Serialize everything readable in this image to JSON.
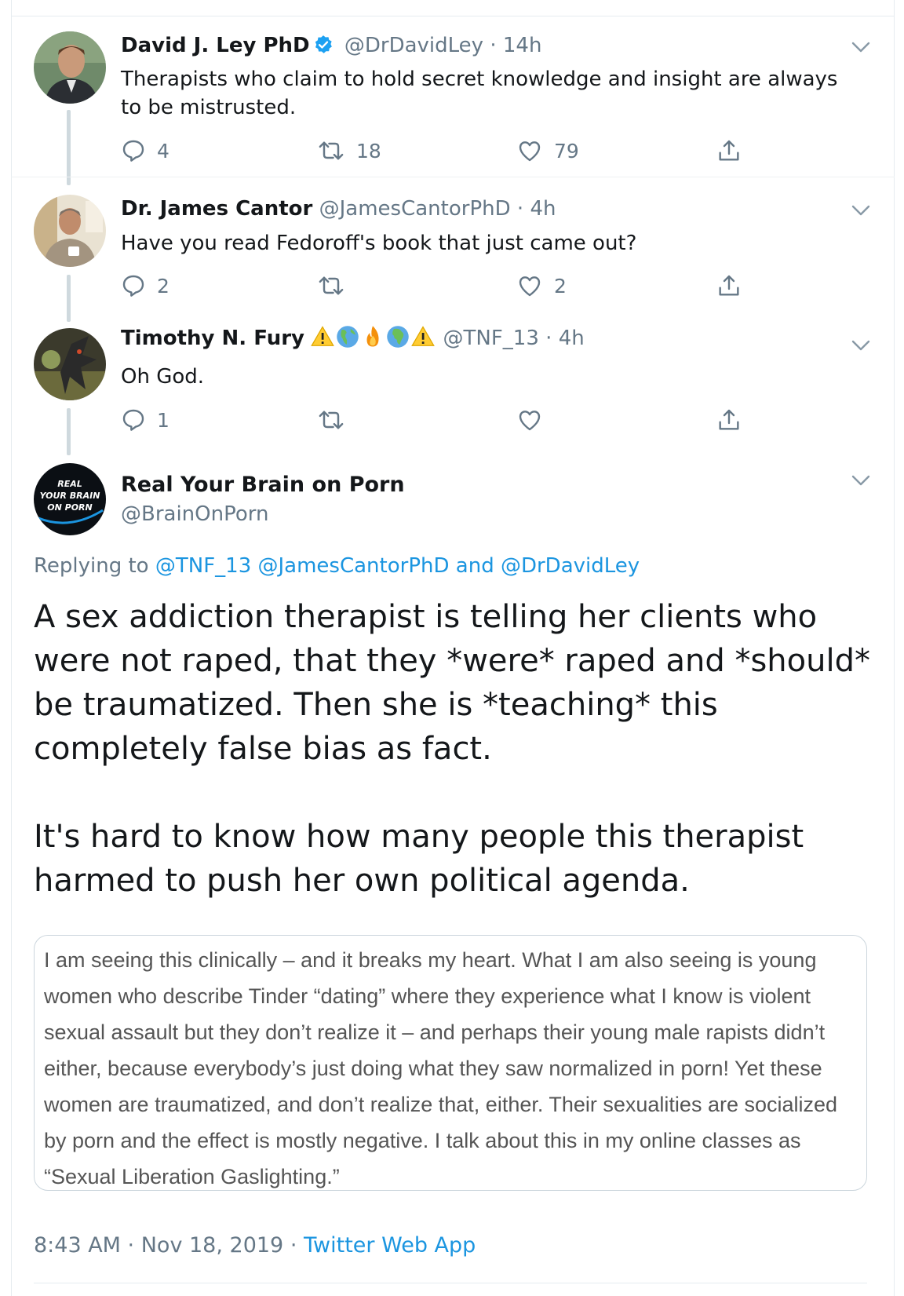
{
  "tweets": [
    {
      "name": "David J. Ley PhD",
      "handle": "@DrDavidLey",
      "separator": "·",
      "time": "14h",
      "text": "Therapists who claim to hold secret knowledge and insight are always to be mistrusted.",
      "reply_count": "4",
      "retweet_count": "18",
      "like_count": "79"
    },
    {
      "name": "Dr. James Cantor",
      "handle": "@JamesCantorPhD",
      "separator": "·",
      "time": "4h",
      "text": "Have you read Fedoroff's book that just came out?",
      "reply_count": "2",
      "retweet_count": "",
      "like_count": "2"
    },
    {
      "name": "Timothy N. Fury",
      "handle": "@TNF_13",
      "separator": "·",
      "time": "4h",
      "text": "Oh God.",
      "reply_count": "1",
      "retweet_count": "",
      "like_count": ""
    }
  ],
  "main_tweet": {
    "name": "Real Your Brain on Porn",
    "handle": "@BrainOnPorn",
    "avatar_text": [
      "REAL",
      "YOUR BRAIN",
      "ON PORN"
    ],
    "replying_prefix": "Replying to",
    "replying_to": [
      "@TNF_13",
      "@JamesCantorPhD",
      "@DrDavidLey"
    ],
    "replying_and": "and",
    "paragraphs": [
      "A sex addiction therapist is telling her clients who were not raped, that they *were* raped and *should* be traumatized. Then she is *teaching* this completely false bias as fact.",
      "It's hard to know how many people this therapist harmed to push her own political agenda."
    ],
    "quote_text": "I am seeing this clinically – and it breaks my heart. What I am also seeing is young women who describe Tinder “dating” where they experience what I know is violent sexual assault but they don’t realize it – and perhaps their young male rapists didn’t either, because everybody’s just doing what they saw normalized in porn! Yet these women are traumatized, and don’t realize that, either. Their sexualities are socialized by porn and the effect is mostly negative. I talk about this in my online classes as “Sexual Liberation Gaslighting.”",
    "timestamp": "8:43 AM · Nov 18, 2019",
    "footer_separator": "·",
    "source_app": "Twitter Web App"
  },
  "icons": {
    "reply": "reply-icon",
    "retweet": "retweet-icon",
    "like": "like-icon",
    "share": "share-icon",
    "more": "chevron-down-icon",
    "verified": "verified-badge-icon",
    "emoji_sequence": [
      "warning-icon",
      "globe-americas-icon",
      "fire-icon",
      "globe-africa-icon",
      "warning-icon"
    ]
  },
  "colors": {
    "link": "#1b95e0",
    "secondary_text": "#657786",
    "thread_line": "#cfd9de",
    "verified": "#1da1f2"
  }
}
